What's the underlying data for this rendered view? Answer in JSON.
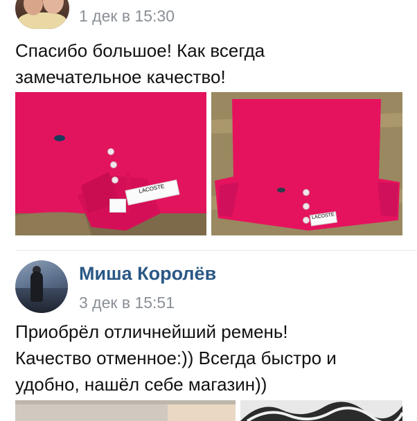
{
  "posts": [
    {
      "author": "",
      "time": "1 дек в 15:30",
      "text": "Спасибо большое! Как всегда\nзамечательное качество!"
    },
    {
      "author": "Миша Королёв",
      "time": "3 дек в 15:51",
      "text": "Приобрёл отличнейший ремень!\nКачество отменное:)) Всегда быстро и\nудобно, нашёл себе магазин))"
    }
  ],
  "colors": {
    "author": "#2a5885",
    "timestamp": "#8a8f96",
    "separator": "#e5e6e8",
    "shirt": "#e5135e"
  },
  "photos": {
    "tag1": "LACOSTE",
    "tag2": "LACOSTE"
  }
}
